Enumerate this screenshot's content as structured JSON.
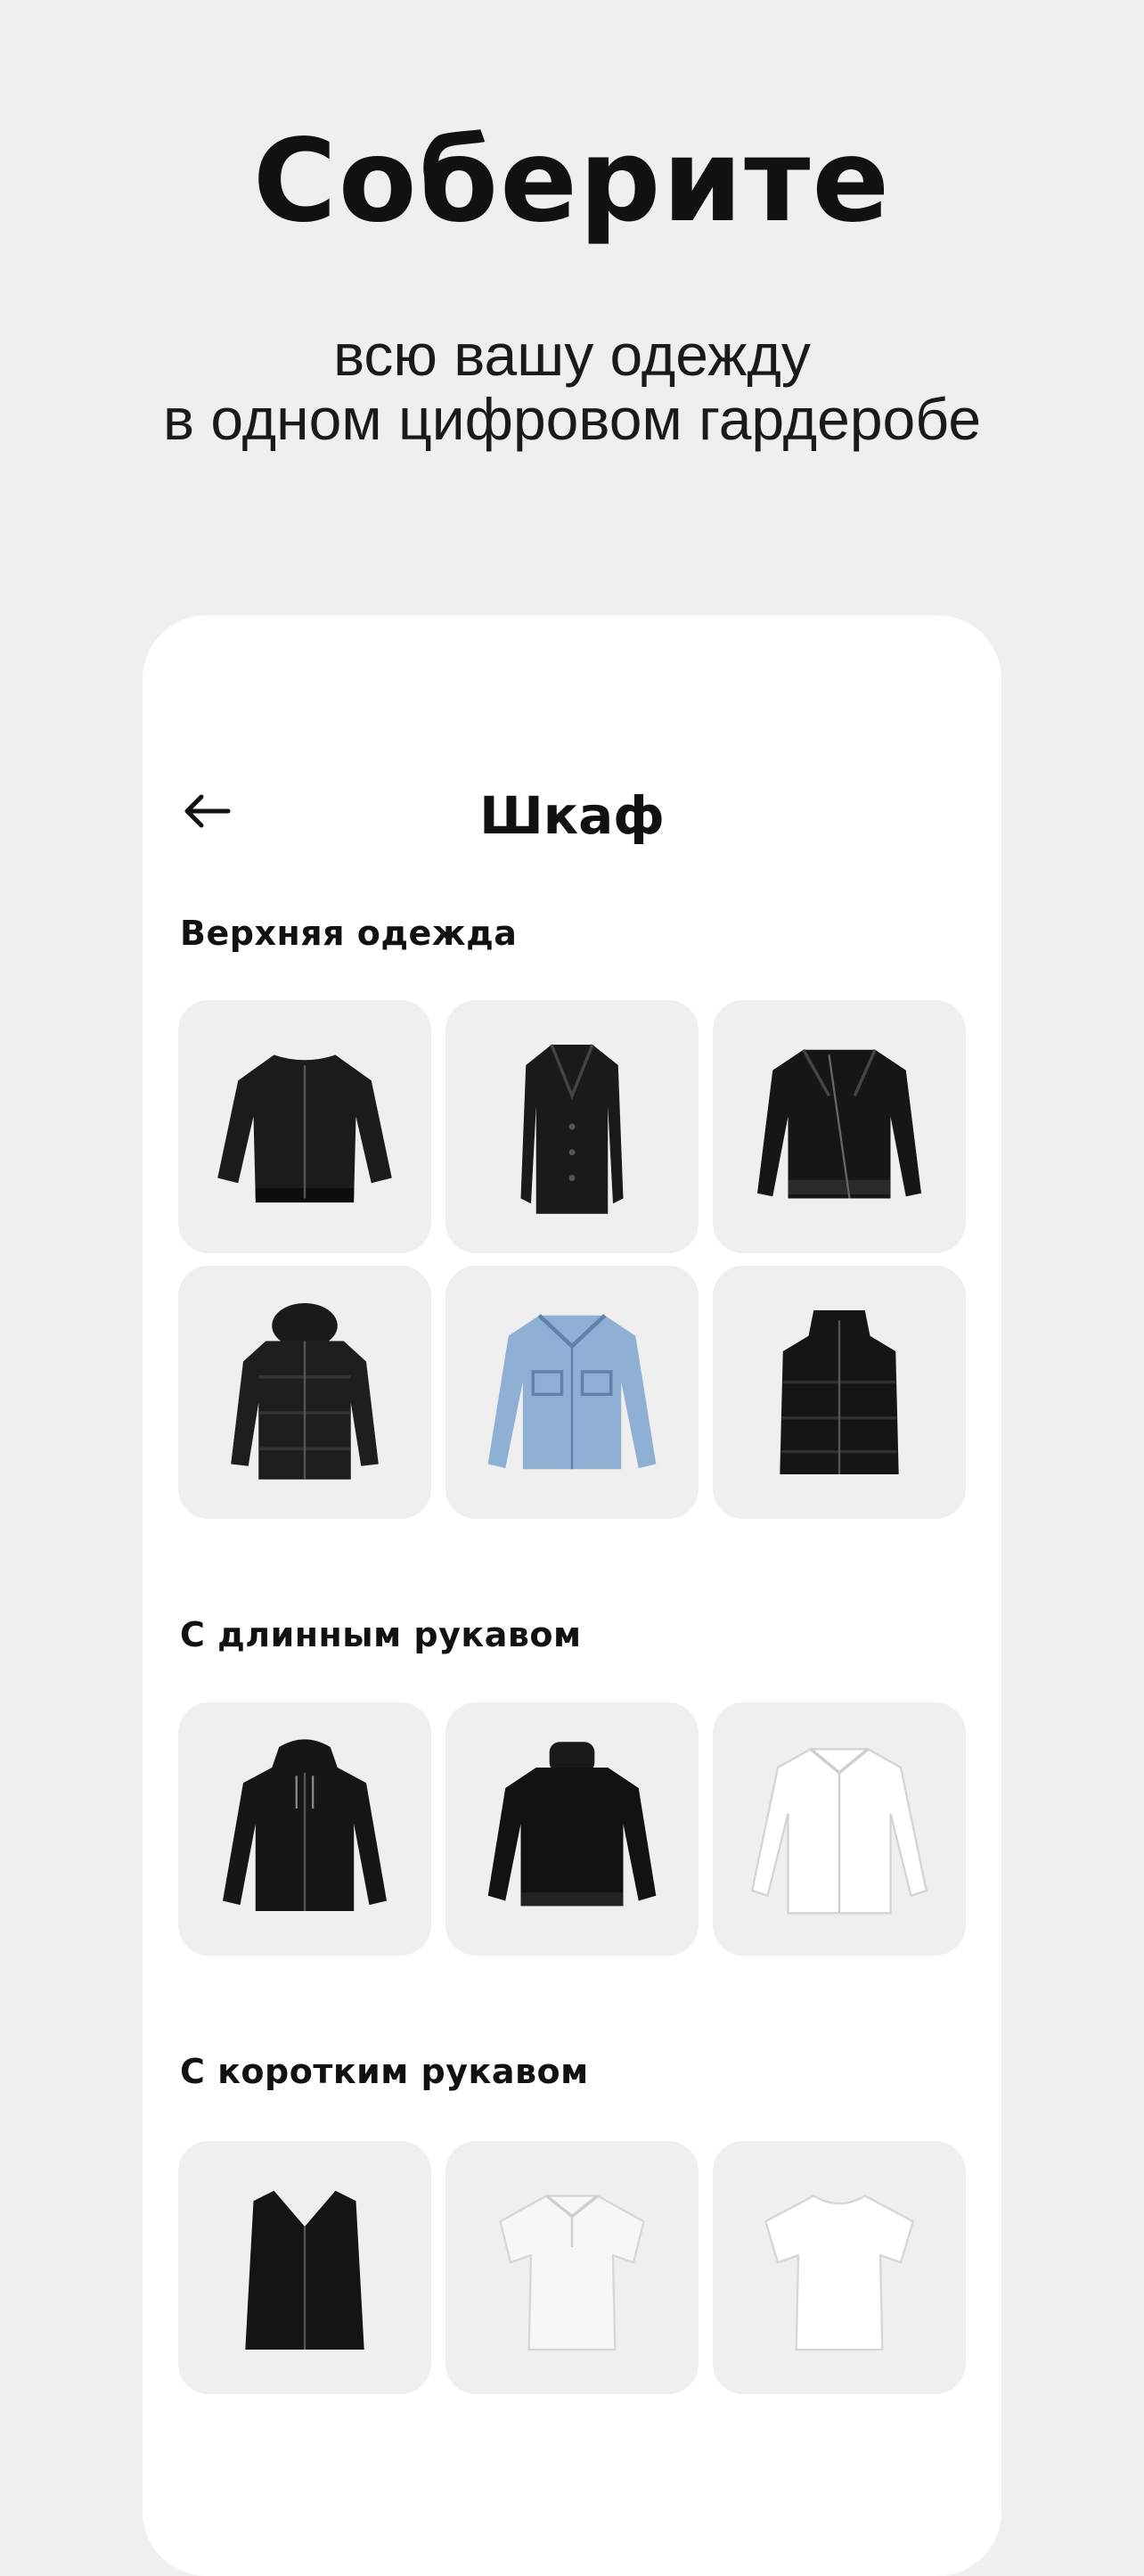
{
  "hero": {
    "title": "Соберите",
    "subtitle_line1": "всю вашу одежду",
    "subtitle_line2": "в одном цифровом гардеробе"
  },
  "screen": {
    "back_icon": "arrow-left-icon",
    "title": "Шкаф"
  },
  "sections": [
    {
      "title": "Верхняя одежда",
      "items": [
        "bomber-jacket",
        "black-coat",
        "leather-jacket",
        "puffer-jacket",
        "denim-jacket",
        "puffer-vest"
      ]
    },
    {
      "title": "С длинным рукавом",
      "items": [
        "black-hoodie",
        "black-sweater",
        "white-shirt"
      ]
    },
    {
      "title": "С коротким рукавом",
      "items": [
        "black-vest",
        "white-polo",
        "white-tshirt"
      ]
    }
  ],
  "colors": {
    "background": "#efefef",
    "card": "#ffffff",
    "tile": "#efefef",
    "text": "#111111",
    "denim": "#8fb0d4"
  }
}
